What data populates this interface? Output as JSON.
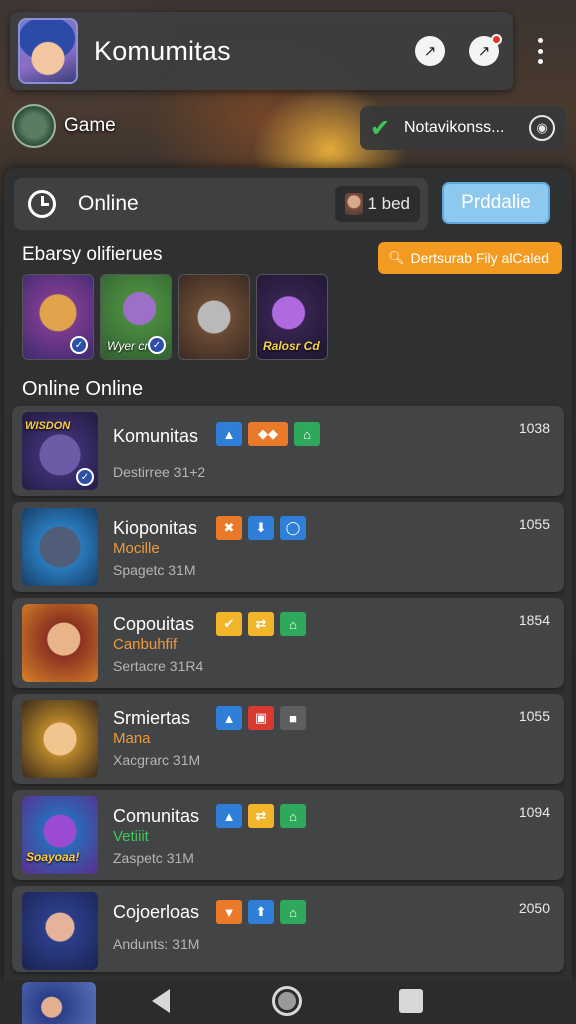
{
  "header": {
    "title": "Komumitas"
  },
  "game": {
    "label": "Game"
  },
  "notification": {
    "text": "Notavikonss..."
  },
  "status": {
    "online_label": "Online",
    "bed_text": "1 bed",
    "primary_button": "Prddalie"
  },
  "featured": {
    "heading": "Ebarsy olifierues",
    "search_button": "Dertsurab Fily alCaled",
    "thumbs": [
      {
        "caption": ""
      },
      {
        "caption": "Wyer cruc"
      },
      {
        "caption": ""
      },
      {
        "caption": "Ralosr Cd"
      }
    ]
  },
  "list": {
    "heading": "Online Online",
    "rows": [
      {
        "title": "Komunitas",
        "subtitle": "",
        "meta": "Destirree 31+2",
        "count": "1038",
        "thumb_label": "WISDON"
      },
      {
        "title": "Kioponitas",
        "subtitle": "Mocille",
        "meta": "Spagetc 31M",
        "count": "1055",
        "thumb_label": ""
      },
      {
        "title": "Copouitas",
        "subtitle": "Canbuhfif",
        "meta": "Sertacre 31R4",
        "count": "1854",
        "thumb_label": ""
      },
      {
        "title": "Srmiertas",
        "subtitle": "Mana",
        "meta": "Xacgrarc 31M",
        "count": "1055",
        "thumb_label": ""
      },
      {
        "title": "Comunitas",
        "subtitle": "Vetiiit",
        "meta": "Zaspetc 31M",
        "count": "1094",
        "thumb_label": "Soayoaa!"
      },
      {
        "title": "Cojoerloas",
        "subtitle": "",
        "meta": "Andunts: 31M",
        "count": "2050",
        "thumb_label": ""
      }
    ]
  },
  "colors": {
    "accent_blue": "#8dc8ee",
    "accent_orange": "#f39a21",
    "subtitle_orange": "#f09a3a",
    "subtitle_green": "#3cc95a"
  }
}
